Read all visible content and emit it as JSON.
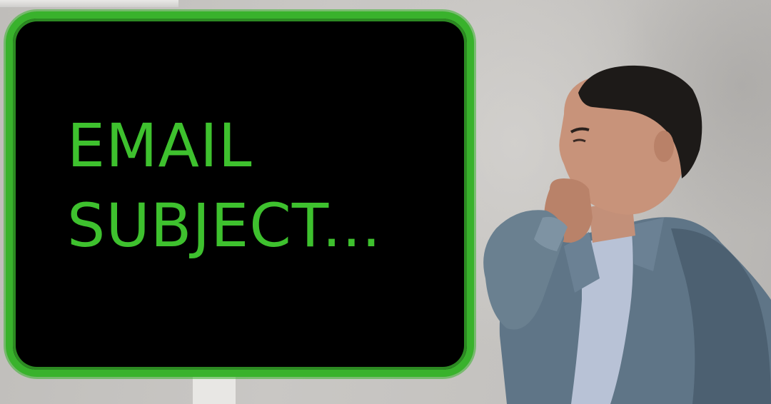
{
  "board": {
    "line1": "EMAIL",
    "line2": "SUBJECT...",
    "text_color": "#3ec12e",
    "border_color": "#39b22c",
    "background_color": "#000000"
  }
}
